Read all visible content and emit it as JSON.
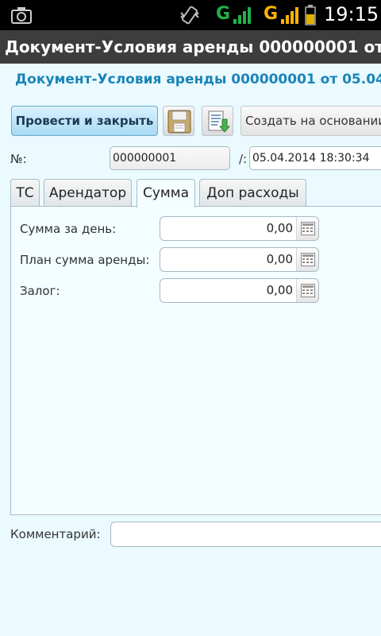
{
  "status_bar": {
    "network_1": "G",
    "network_2": "G",
    "time": "19:15"
  },
  "window_title": "Документ-Условия аренды 000000001 от 05...",
  "doc_heading": "Документ-Условия аренды 000000001 от 05.04...",
  "toolbar": {
    "post_close_label": "Провести и закрыть",
    "create_based_label": "Создать на основании"
  },
  "header_fields": {
    "number_label": "№:",
    "number_value": "000000001",
    "date_label": "/:",
    "date_value": "05.04.2014 18:30:34"
  },
  "tabs": [
    {
      "label": "ТС",
      "active": false
    },
    {
      "label": "Арендатор",
      "active": false
    },
    {
      "label": "Сумма",
      "active": true
    },
    {
      "label": "Доп расходы",
      "active": false
    }
  ],
  "amount_tab": {
    "daily_label": "Сумма за день:",
    "daily_value": "0,00",
    "plan_label": "План сумма аренды:",
    "plan_value": "0,00",
    "deposit_label": "Залог:",
    "deposit_value": "0,00"
  },
  "comment": {
    "label": "Комментарий:",
    "value": ""
  },
  "colors": {
    "background": "#eafaff",
    "heading": "#1a84b8",
    "title_bar": "#3d3d3d",
    "signal_green": "#22b14c",
    "signal_orange": "#ffb300"
  }
}
